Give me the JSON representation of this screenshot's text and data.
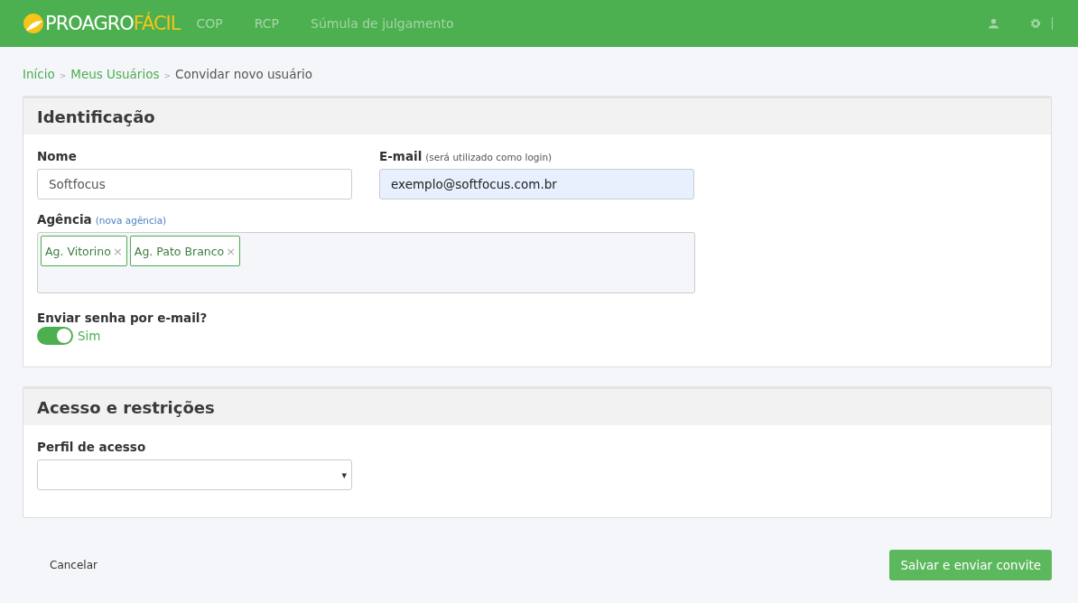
{
  "header": {
    "logo": {
      "part_1": "PROAGRO",
      "part_2": "FÁCIL"
    },
    "nav": [
      {
        "label": "COP"
      },
      {
        "label": "RCP"
      },
      {
        "label": "Súmula de julgamento"
      }
    ]
  },
  "breadcrumb": [
    {
      "kind": "link",
      "label": "Início"
    },
    {
      "kind": "separator",
      "label": ">"
    },
    {
      "kind": "link",
      "label": "Meus Usuários"
    },
    {
      "kind": "separator",
      "label": ">"
    },
    {
      "kind": "current",
      "label": "Convidar novo usuário"
    }
  ],
  "identification": {
    "title": "Identificação",
    "name": {
      "label": "Nome",
      "value": "Softfocus"
    },
    "email": {
      "label": "E-mail",
      "note": "(será utilizado como login)",
      "value": "exemplo@softfocus.com.br"
    },
    "agency": {
      "label": "Agência",
      "link": "(nova agência)",
      "tags": [
        {
          "label": "Ag. Vitorino",
          "remove": "×"
        },
        {
          "label": "Ag. Pato Branco",
          "remove": "×"
        }
      ]
    },
    "send_password": {
      "label": "Enviar senha por e-mail?",
      "on": true,
      "text": "Sim"
    }
  },
  "access": {
    "title": "Acesso e restrições",
    "profile": {
      "label": "Perfil de acesso",
      "caret": "▾"
    }
  },
  "footer": {
    "cancel": "Cancelar",
    "submit": "Salvar e enviar convite"
  }
}
